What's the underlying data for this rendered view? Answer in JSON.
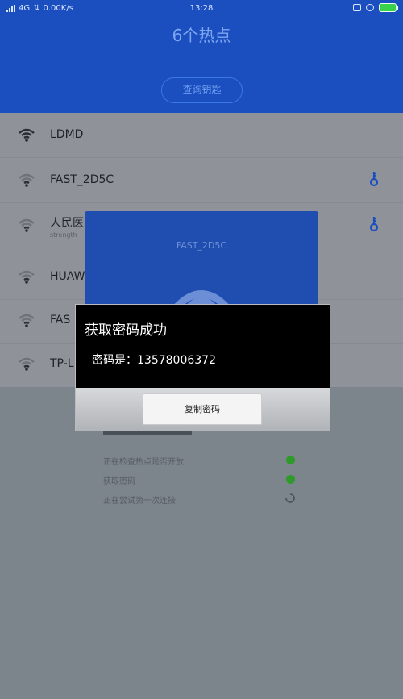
{
  "status_bar": {
    "network": "4G",
    "speed": "0.00K/s",
    "time": "13:28"
  },
  "header": {
    "title": "6个热点",
    "query_button": "查询钥匙"
  },
  "wifi_list": [
    {
      "ssid": "LDMD",
      "sub": "",
      "has_key": false
    },
    {
      "ssid": "FAST_2D5C",
      "sub": "",
      "has_key": true
    },
    {
      "ssid": "人民医",
      "sub": "strength",
      "has_key": true
    },
    {
      "ssid": "HUAW",
      "sub": "",
      "has_key": false
    },
    {
      "ssid": "FAS",
      "sub": "",
      "has_key": false
    },
    {
      "ssid": "TP-L",
      "sub": "",
      "has_key": false
    }
  ],
  "connect_card": {
    "title": "FAST_2D5C"
  },
  "progress": {
    "steps": [
      {
        "label": "正在检查热点是否开放",
        "status": "done"
      },
      {
        "label": "获取密码",
        "status": "done"
      },
      {
        "label": "正在尝试第一次连接",
        "status": "loading"
      }
    ]
  },
  "dialog": {
    "title": "获取密码成功",
    "message": "密码是：13578006372",
    "copy_button": "复制密码"
  },
  "colors": {
    "header_blue": "#1b4fc0",
    "key_blue": "#1b4fc0",
    "success_green": "#2e9a2a"
  }
}
